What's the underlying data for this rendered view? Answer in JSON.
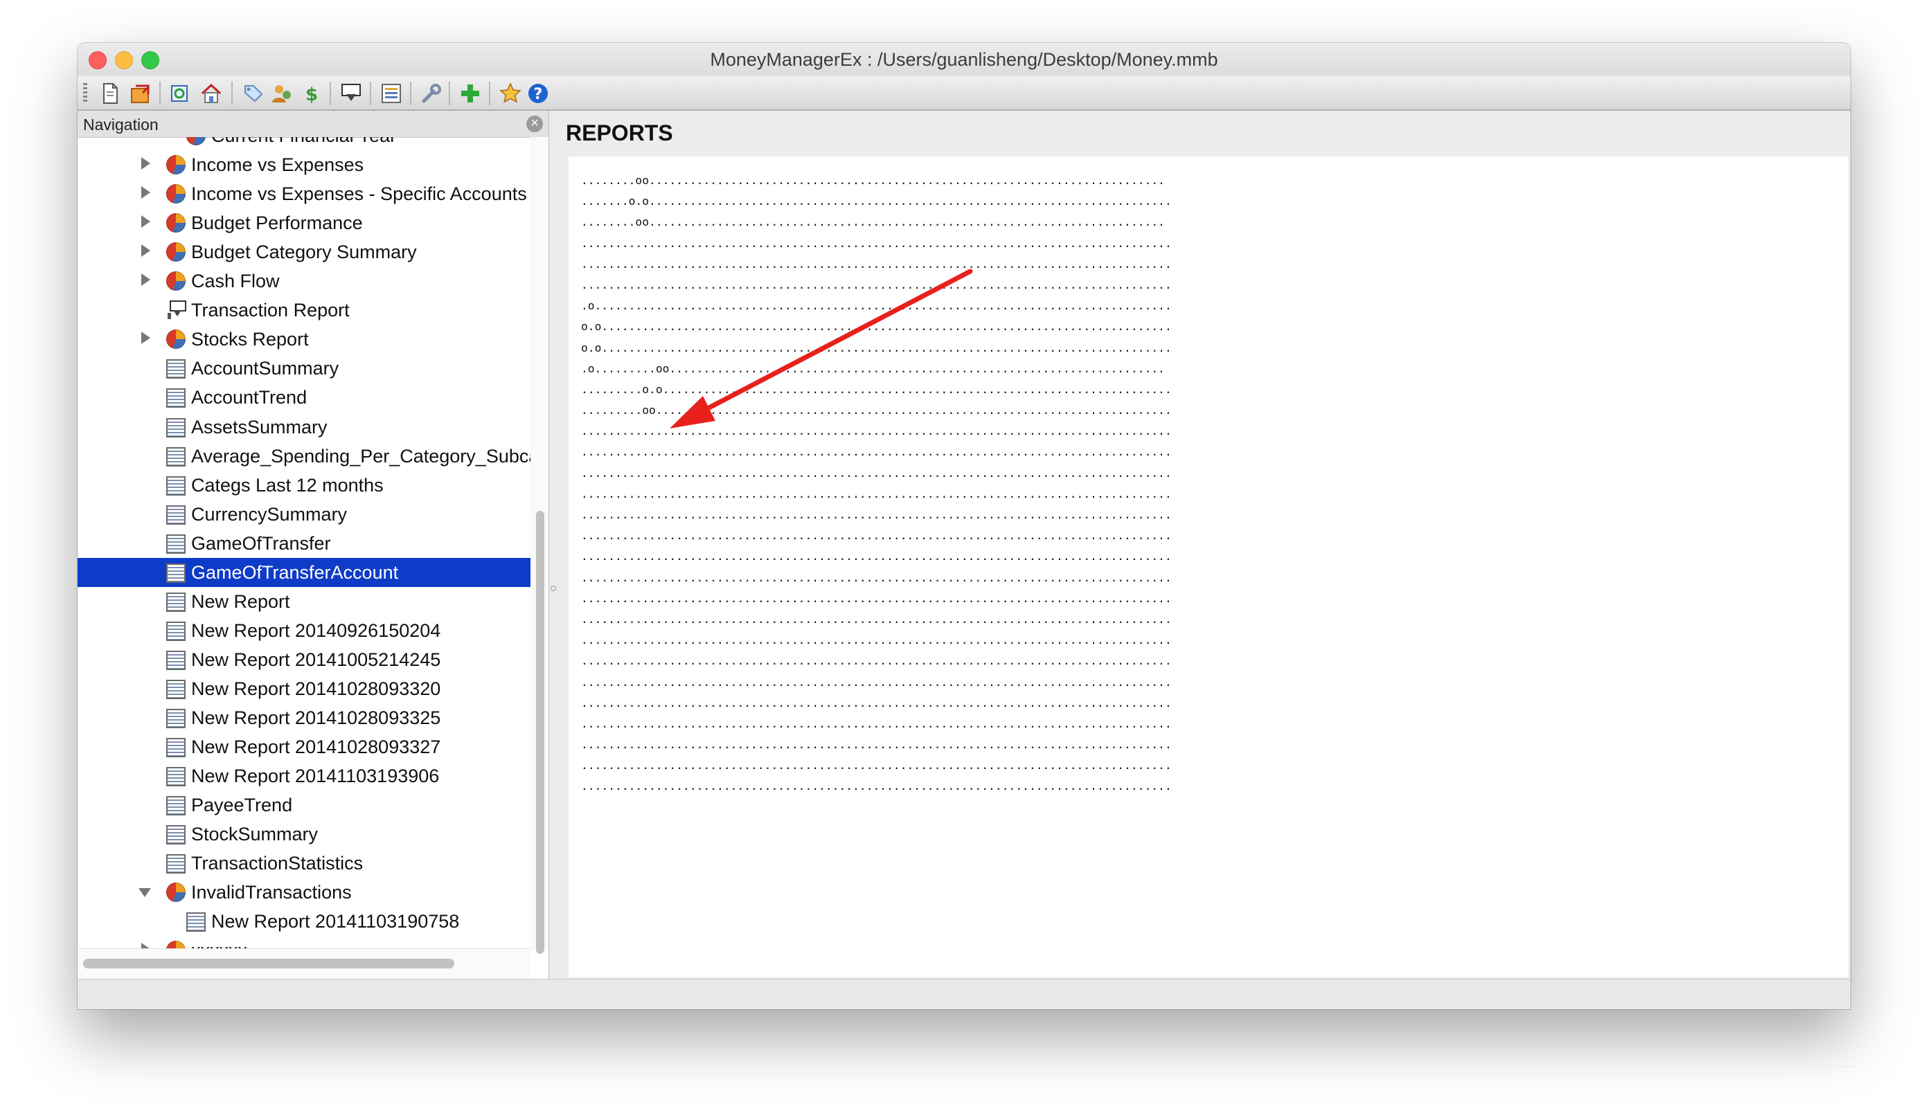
{
  "window": {
    "title": "MoneyManagerEx : /Users/guanlisheng/Desktop/Money.mmb"
  },
  "toolbar": {
    "icons": [
      "new-database-icon",
      "open-database-icon",
      "refresh-icon",
      "home-icon",
      "tags-icon",
      "payees-icon",
      "currency-icon",
      "transaction-filter-icon",
      "budget-icon",
      "options-wrench-icon",
      "add-new-icon",
      "favorite-star-icon",
      "help-icon"
    ]
  },
  "navigation": {
    "header": "Navigation",
    "items": [
      {
        "label": "Current Financial Year",
        "icon": "pie",
        "arrow": "none",
        "indent": 1
      },
      {
        "label": "Income vs Expenses",
        "icon": "pie",
        "arrow": "right",
        "indent": 0
      },
      {
        "label": "Income vs Expenses - Specific Accounts",
        "icon": "pie",
        "arrow": "right",
        "indent": 0
      },
      {
        "label": "Budget Performance",
        "icon": "pie",
        "arrow": "right",
        "indent": 0
      },
      {
        "label": "Budget Category Summary",
        "icon": "pie",
        "arrow": "right",
        "indent": 0
      },
      {
        "label": "Cash Flow",
        "icon": "pie",
        "arrow": "right",
        "indent": 0
      },
      {
        "label": "Transaction Report",
        "icon": "filter",
        "arrow": "none",
        "indent": 0
      },
      {
        "label": "Stocks Report",
        "icon": "pie",
        "arrow": "right",
        "indent": 0
      },
      {
        "label": "AccountSummary",
        "icon": "report",
        "arrow": "none",
        "indent": 0
      },
      {
        "label": "AccountTrend",
        "icon": "report",
        "arrow": "none",
        "indent": 0
      },
      {
        "label": "AssetsSummary",
        "icon": "report",
        "arrow": "none",
        "indent": 0
      },
      {
        "label": "Average_Spending_Per_Category_Subcategory",
        "icon": "report",
        "arrow": "none",
        "indent": 0
      },
      {
        "label": "Categs Last 12 months",
        "icon": "report",
        "arrow": "none",
        "indent": 0
      },
      {
        "label": "CurrencySummary",
        "icon": "report",
        "arrow": "none",
        "indent": 0
      },
      {
        "label": "GameOfTransfer",
        "icon": "report",
        "arrow": "none",
        "indent": 0
      },
      {
        "label": "GameOfTransferAccount",
        "icon": "report",
        "arrow": "none",
        "indent": 0,
        "selected": true
      },
      {
        "label": "New Report",
        "icon": "report",
        "arrow": "none",
        "indent": 0
      },
      {
        "label": "New Report 20140926150204",
        "icon": "report",
        "arrow": "none",
        "indent": 0
      },
      {
        "label": "New Report 20141005214245",
        "icon": "report",
        "arrow": "none",
        "indent": 0
      },
      {
        "label": "New Report 20141028093320",
        "icon": "report",
        "arrow": "none",
        "indent": 0
      },
      {
        "label": "New Report 20141028093325",
        "icon": "report",
        "arrow": "none",
        "indent": 0
      },
      {
        "label": "New Report 20141028093327",
        "icon": "report",
        "arrow": "none",
        "indent": 0
      },
      {
        "label": "New Report 20141103193906",
        "icon": "report",
        "arrow": "none",
        "indent": 0
      },
      {
        "label": "PayeeTrend",
        "icon": "report",
        "arrow": "none",
        "indent": 0
      },
      {
        "label": "StockSummary",
        "icon": "report",
        "arrow": "none",
        "indent": 0
      },
      {
        "label": "TransactionStatistics",
        "icon": "report",
        "arrow": "none",
        "indent": 0
      },
      {
        "label": "InvalidTransactions",
        "icon": "pie",
        "arrow": "down",
        "indent": 0
      },
      {
        "label": "New Report 20141103190758",
        "icon": "report",
        "arrow": "none",
        "indent": 1
      },
      {
        "label": "xxxxxx",
        "icon": "pie",
        "arrow": "right",
        "indent": 0
      }
    ]
  },
  "report": {
    "title": "REPORTS",
    "lines": [
      "........oo............................................................................",
      ".......o.o.............................................................................",
      "........oo............................................................................",
      ".......................................................................................",
      ".......................................................................................",
      ".......................................................................................",
      ".o.....................................................................................",
      "o.o....................................................................................",
      "o.o....................................................................................",
      ".o.........oo.........................................................................",
      ".........o.o...........................................................................",
      ".........oo............................................................................",
      ".......................................................................................",
      ".......................................................................................",
      ".......................................................................................",
      ".......................................................................................",
      ".......................................................................................",
      ".......................................................................................",
      ".......................................................................................",
      ".......................................................................................",
      ".......................................................................................",
      ".......................................................................................",
      ".......................................................................................",
      ".......................................................................................",
      ".......................................................................................",
      ".......................................................................................",
      ".......................................................................................",
      ".......................................................................................",
      ".......................................................................................",
      "......................................................................................."
    ],
    "annotation_color": "#e8201c"
  }
}
